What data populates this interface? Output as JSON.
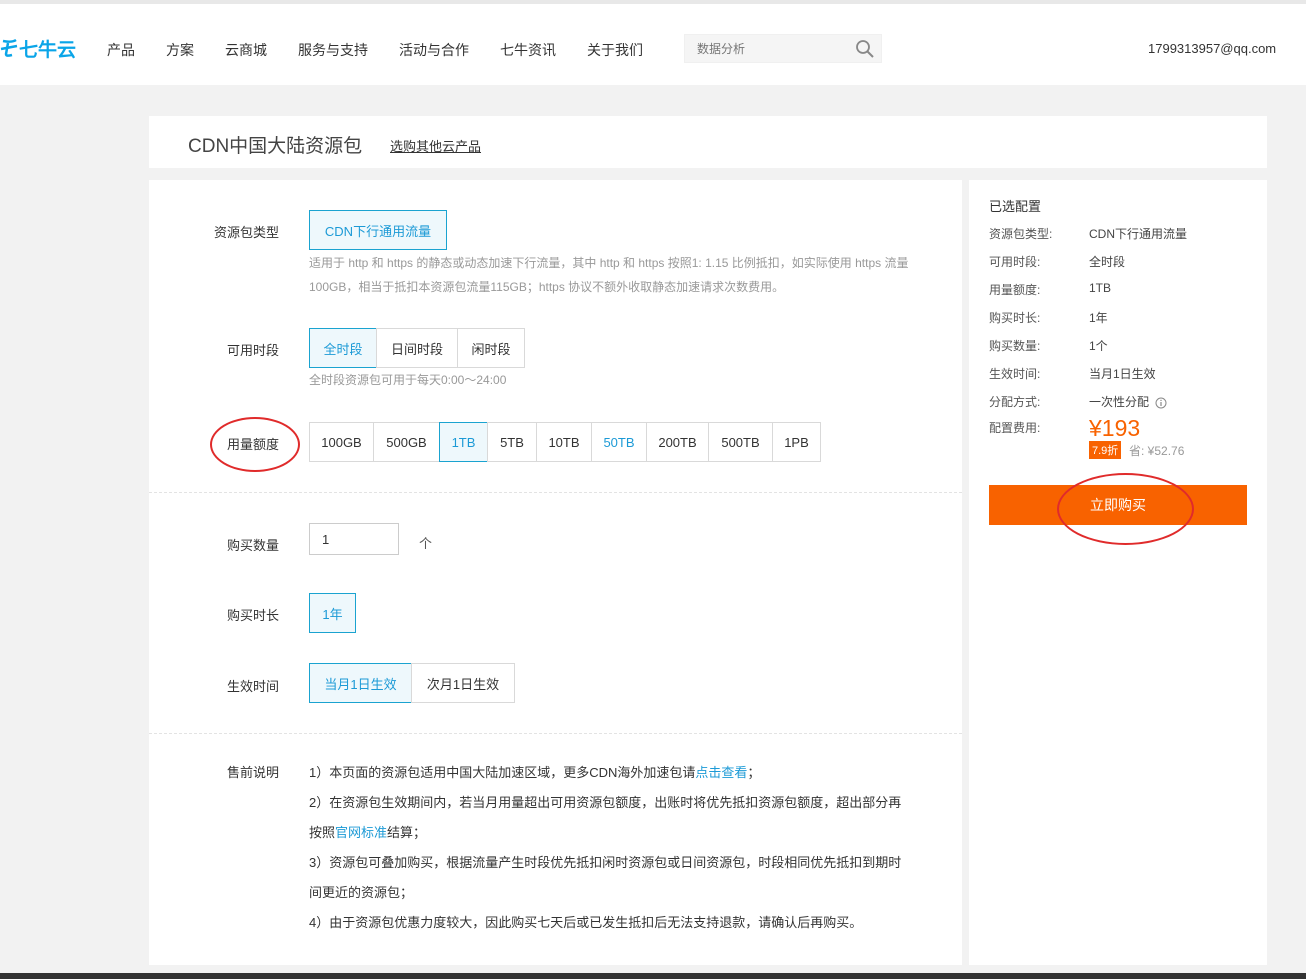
{
  "brand": {
    "name": "七牛云",
    "color": "#0aa5e8"
  },
  "nav": [
    "产品",
    "方案",
    "云商城",
    "服务与支持",
    "活动与合作",
    "七牛资讯",
    "关于我们"
  ],
  "search": {
    "placeholder": "数据分析",
    "icon": "search-icon"
  },
  "user": {
    "email": "1799313957@qq.com"
  },
  "page": {
    "title": "CDN中国大陆资源包",
    "other_link": "选购其他云产品"
  },
  "form": {
    "package_type": {
      "label": "资源包类型",
      "options": [
        "CDN下行通用流量"
      ],
      "selected": "CDN下行通用流量",
      "hint_line1": "适用于 http 和 https 的静态或动态加速下行流量，其中 http 和 https 按照1: 1.15 比例抵扣，如实际使用 https 流量",
      "hint_line2": "100GB，相当于抵扣本资源包流量115GB；https 协议不额外收取静态加速请求次数费用。"
    },
    "period": {
      "label": "可用时段",
      "options": [
        "全时段",
        "日间时段",
        "闲时段"
      ],
      "selected": "全时段",
      "hint": "全时段资源包可用于每天0:00～24:00"
    },
    "quota": {
      "label": "用量额度",
      "options": [
        "100GB",
        "500GB",
        "1TB",
        "5TB",
        "10TB",
        "50TB",
        "200TB",
        "500TB",
        "1PB"
      ],
      "selected": "1TB"
    },
    "quantity": {
      "label": "购买数量",
      "value": "1",
      "unit": "个"
    },
    "duration": {
      "label": "购买时长",
      "options": [
        "1年"
      ],
      "selected": "1年"
    },
    "effective": {
      "label": "生效时间",
      "options": [
        "当月1日生效",
        "次月1日生效"
      ],
      "selected": "当月1日生效"
    },
    "notes": {
      "label": "售前说明",
      "n1_a": "1）本页面的资源包适用中国大陆加速区域，更多CDN海外加速包请",
      "n1_link": "点击查看",
      "n1_b": "；",
      "n2_a": "2）在资源包生效期间内，若当月用量超出可用资源包额度，出账时将优先抵扣资源包额度，超出部分再",
      "n2_b": "按照",
      "n2_link": "官网标准",
      "n2_c": "结算；",
      "n3_a": "3）资源包可叠加购买，根据流量产生时段优先抵扣闲时资源包或日间资源包，时段相同优先抵扣到期时",
      "n3_b": "间更近的资源包；",
      "n4": "4）由于资源包优惠力度较大，因此购买七天后或已发生抵扣后无法支持退款，请确认后再购买。"
    }
  },
  "summary": {
    "title": "已选配置",
    "rows": [
      {
        "k": "资源包类型:",
        "v": "CDN下行通用流量"
      },
      {
        "k": "可用时段:",
        "v": "全时段"
      },
      {
        "k": "用量额度:",
        "v": "1TB"
      },
      {
        "k": "购买时长:",
        "v": "1年"
      },
      {
        "k": "购买数量:",
        "v": "1个"
      },
      {
        "k": "生效时间:",
        "v": "当月1日生效"
      },
      {
        "k": "分配方式:",
        "v": "一次性分配"
      },
      {
        "k": "配置费用:",
        "v": ""
      }
    ],
    "price": "¥193",
    "discount": "7.9折",
    "saving": "省: ¥52.76",
    "buy_label": "立即购买",
    "accent": "#f86200"
  }
}
